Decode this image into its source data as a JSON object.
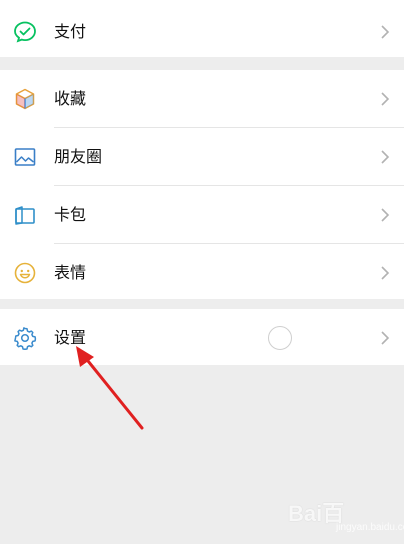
{
  "menu": {
    "pay": {
      "label": "支付",
      "icon": "wechat-pay-icon"
    },
    "favorites": {
      "label": "收藏",
      "icon": "cube-icon"
    },
    "moments": {
      "label": "朋友圈",
      "icon": "landscape-photo-icon"
    },
    "cards": {
      "label": "卡包",
      "icon": "wallet-card-icon"
    },
    "stickers": {
      "label": "表情",
      "icon": "smiley-icon"
    },
    "settings": {
      "label": "设置",
      "icon": "gear-icon"
    }
  },
  "watermark": {
    "brand": "Bai百",
    "sub": "jingyan.baidu.com"
  },
  "colors": {
    "background": "#ededed",
    "row": "#ffffff",
    "pay_green": "#07c160",
    "settings_blue": "#3a8bcd",
    "annotation_arrow": "#e02020"
  }
}
